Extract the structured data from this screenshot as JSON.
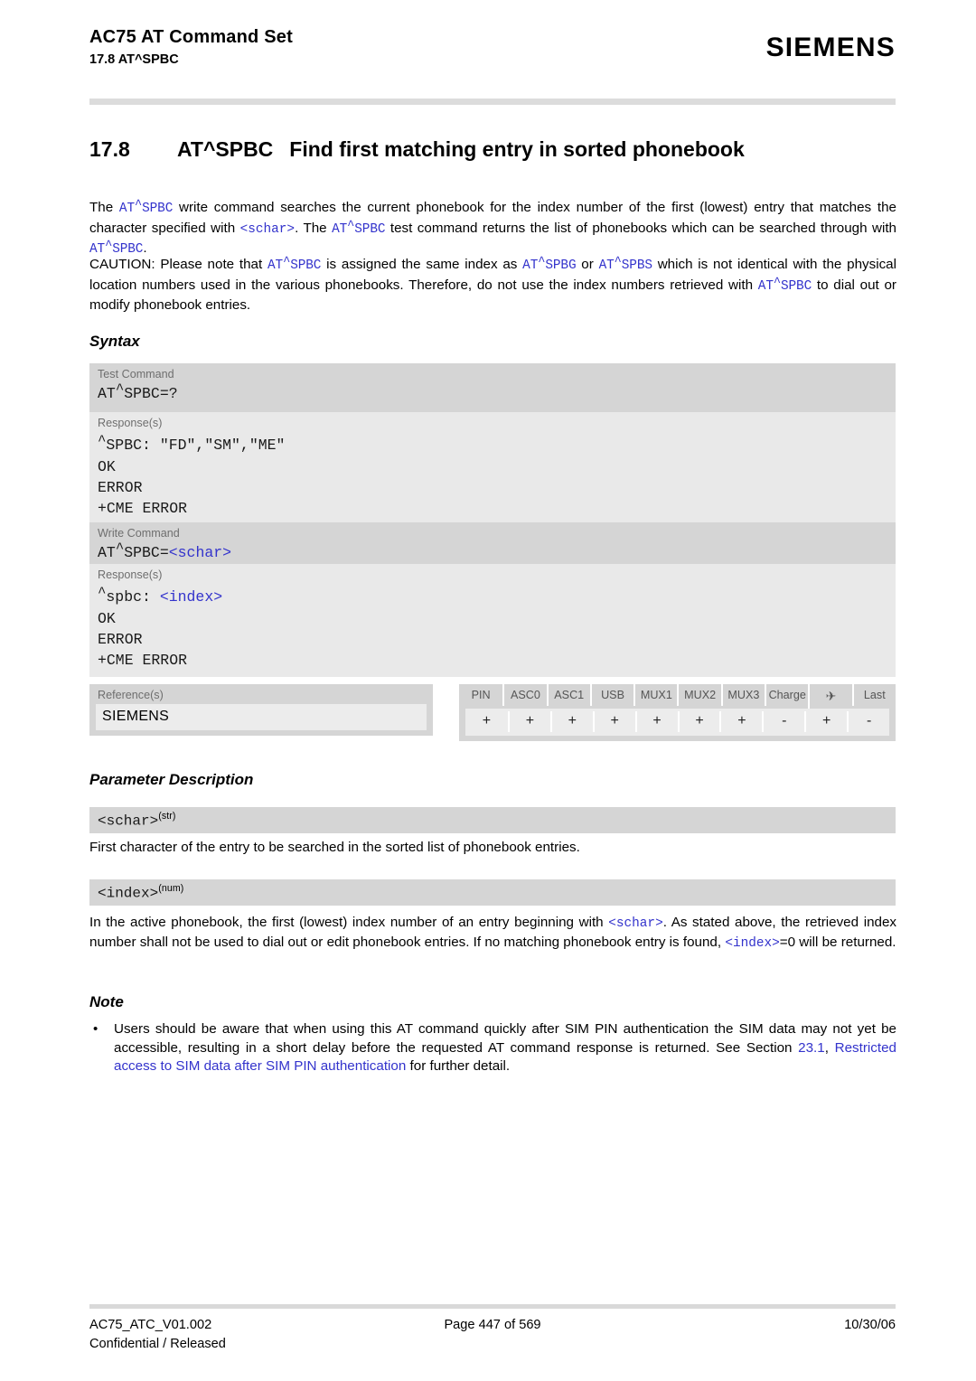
{
  "header": {
    "title": "AC75 AT Command Set",
    "subtitle": "17.8 AT^SPBC",
    "logo": "SIEMENS"
  },
  "section": {
    "number": "17.8",
    "command": "AT^SPBC",
    "title": "Find first matching entry in sorted phonebook"
  },
  "intro": {
    "t1": "The ",
    "c1_at": "AT",
    "c1_caret": "^",
    "c1_rest": "SPBC",
    "t2": " write command searches the current phonebook for the index number of the first (lowest) entry that matches the character specified with ",
    "p1": "<schar>",
    "t3": ". The ",
    "c2_at": "AT",
    "c2_caret": "^",
    "c2_rest": "SPBC",
    "t4": " test command returns the list of phonebooks which can be searched through with ",
    "c3_at": "AT",
    "c3_caret": "^",
    "c3_rest": "SPBC",
    "t5": "."
  },
  "caution": {
    "t1": "CAUTION: Please note that ",
    "c1_at": "AT",
    "c1_caret": "^",
    "c1_rest": "SPBC",
    "t2": " is assigned the same index as ",
    "c2_at": "AT",
    "c2_caret": "^",
    "c2_rest": "SPBG",
    "t3": " or ",
    "c3_at": "AT",
    "c3_caret": "^",
    "c3_rest": "SPBS",
    "t4": " which is not identical with the physical location numbers used in the various phonebooks. Therefore, do not use the index numbers retrieved with ",
    "c4_at": "AT",
    "c4_caret": "^",
    "c4_rest": "SPBC",
    "t5": " to dial out or modify phonebook entries."
  },
  "headings": {
    "syntax": "Syntax",
    "parameter_description": "Parameter Description",
    "note": "Note"
  },
  "syntax": {
    "test": {
      "label": "Test Command",
      "command_pre": "AT",
      "command_caret": "^",
      "command_post": "SPBC=?",
      "response_label": "Response(s)",
      "responses": [
        {
          "pre": "",
          "caret": "^",
          "post": "SPBC: \"FD\",\"SM\",\"ME\""
        },
        {
          "pre": "OK",
          "caret": "",
          "post": ""
        },
        {
          "pre": "ERROR",
          "caret": "",
          "post": ""
        },
        {
          "pre": "+CME ERROR",
          "caret": "",
          "post": ""
        }
      ]
    },
    "write": {
      "label": "Write Command",
      "command_pre": "AT",
      "command_caret": "^",
      "command_post": "SPBC=",
      "command_param": "<schar>",
      "response_label": "Response(s)",
      "response_first_caret": "^",
      "response_first_pre": "spbc: ",
      "response_first_param": "<index>",
      "responses": [
        "OK",
        "ERROR",
        "+CME ERROR"
      ]
    }
  },
  "reference": {
    "label": "Reference(s)",
    "value": "SIEMENS"
  },
  "capabilities": {
    "columns": [
      {
        "name": "PIN",
        "value": "+"
      },
      {
        "name": "ASC0",
        "value": "+"
      },
      {
        "name": "ASC1",
        "value": "+"
      },
      {
        "name": "USB",
        "value": "+"
      },
      {
        "name": "MUX1",
        "value": "+"
      },
      {
        "name": "MUX2",
        "value": "+"
      },
      {
        "name": "MUX3",
        "value": "+"
      },
      {
        "name": "Charge",
        "value": "-"
      },
      {
        "name": "✈",
        "value": "+"
      },
      {
        "name": "Last",
        "value": "-"
      }
    ]
  },
  "parameters": [
    {
      "name": "<schar>",
      "type": "(str)",
      "description": "First character of the entry to be searched in the sorted list of phonebook entries."
    },
    {
      "name": "<index>",
      "type": "(num)",
      "desc_t1": "In the active phonebook, the first (lowest) index number of an entry beginning with ",
      "desc_p1": "<schar>",
      "desc_t2": ". As stated above, the retrieved index number shall not be used to dial out or edit phonebook entries. If no matching phonebook entry is found, ",
      "desc_p2": "<index>",
      "desc_t3": "=0 will be returned."
    }
  ],
  "note": {
    "bullet": "•",
    "t1": "Users should be aware that when using this AT command quickly after SIM PIN authentication the SIM data may not yet be accessible, resulting in a short delay before the requested AT command response is returned. See Section ",
    "link_num": "23.1",
    "t2": ", ",
    "link_text": "Restricted access to SIM data after SIM PIN authentication",
    "t3": " for further detail."
  },
  "footer": {
    "doc_id": "AC75_ATC_V01.002",
    "page": "Page 447 of 569",
    "date": "10/30/06",
    "classification": "Confidential / Released"
  },
  "colors": {
    "link": "#3333cc",
    "command_row": "#d5d5d5",
    "response_row": "#e9e9e9",
    "rule": "#dcdcdc"
  }
}
